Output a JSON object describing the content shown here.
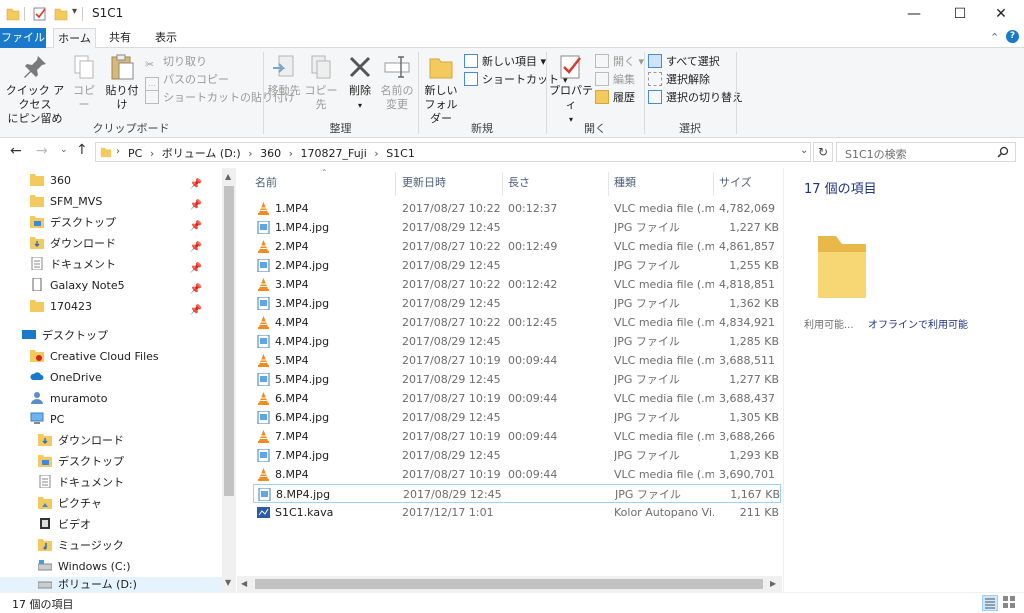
{
  "window": {
    "title": "S1C1",
    "controls": {
      "minimize": "—",
      "maximize": "☐",
      "close": "✕"
    }
  },
  "ribbon_tabs": [
    {
      "label": "ファイル"
    },
    {
      "label": "ホーム"
    },
    {
      "label": "共有"
    },
    {
      "label": "表示"
    }
  ],
  "ribbon": {
    "clipboard": {
      "pin_label": "クイック アクセス",
      "pin_label2": "にピン留め",
      "copy": "コピー",
      "paste": "貼り付け",
      "cut": "切り取り",
      "copy_path": "パスのコピー",
      "paste_shortcut": "ショートカットの貼り付け",
      "group": "クリップボード"
    },
    "organize": {
      "move_to": "移動先",
      "copy_to": "コピー先",
      "delete": "削除",
      "rename": "名前の",
      "rename2": "変更",
      "group": "整理"
    },
    "new": {
      "new_folder": "新しい",
      "new_folder2": "フォルダー",
      "new_item": "新しい項目",
      "shortcut": "ショートカット",
      "group": "新規"
    },
    "open": {
      "properties": "プロパティ",
      "open": "開く",
      "edit": "編集",
      "history": "履歴",
      "group": "開く"
    },
    "select": {
      "select_all": "すべて選択",
      "select_none": "選択解除",
      "invert": "選択の切り替え",
      "group": "選択"
    }
  },
  "address": {
    "segments": [
      "PC",
      "ボリューム (D:)",
      "360",
      "170827_Fuji",
      "S1C1"
    ],
    "search_placeholder": "S1C1の検索"
  },
  "nav": {
    "quick": [
      {
        "label": "360",
        "pinned": true
      },
      {
        "label": "SFM_MVS",
        "pinned": true
      },
      {
        "label": "デスクトップ",
        "pinned": true
      },
      {
        "label": "ダウンロード",
        "pinned": true
      },
      {
        "label": "ドキュメント",
        "pinned": true
      },
      {
        "label": "Galaxy Note5",
        "pinned": true
      },
      {
        "label": "170423",
        "pinned": true
      }
    ],
    "desktop": "デスクトップ",
    "creative_cloud": "Creative Cloud Files",
    "onedrive": "OneDrive",
    "user": "muramoto",
    "pc": "PC",
    "pc_children": [
      "ダウンロード",
      "デスクトップ",
      "ドキュメント",
      "ピクチャ",
      "ビデオ",
      "ミュージック",
      "Windows (C:)",
      "ボリューム (D:)"
    ]
  },
  "columns": {
    "name": "名前",
    "date": "更新日時",
    "length": "長さ",
    "type": "種類",
    "size": "サイズ"
  },
  "files": [
    {
      "name": "1.MP4",
      "date": "2017/08/27 10:22",
      "length": "00:12:37",
      "type": "VLC media file (.m...",
      "size": "4,782,069 ...",
      "icon": "vlc"
    },
    {
      "name": "1.MP4.jpg",
      "date": "2017/08/29 12:45",
      "length": "",
      "type": "JPG ファイル",
      "size": "1,227 KB",
      "icon": "jpg"
    },
    {
      "name": "2.MP4",
      "date": "2017/08/27 10:22",
      "length": "00:12:49",
      "type": "VLC media file (.m...",
      "size": "4,861,857 ...",
      "icon": "vlc"
    },
    {
      "name": "2.MP4.jpg",
      "date": "2017/08/29 12:45",
      "length": "",
      "type": "JPG ファイル",
      "size": "1,255 KB",
      "icon": "jpg"
    },
    {
      "name": "3.MP4",
      "date": "2017/08/27 10:22",
      "length": "00:12:42",
      "type": "VLC media file (.m...",
      "size": "4,818,851 ...",
      "icon": "vlc"
    },
    {
      "name": "3.MP4.jpg",
      "date": "2017/08/29 12:45",
      "length": "",
      "type": "JPG ファイル",
      "size": "1,362 KB",
      "icon": "jpg"
    },
    {
      "name": "4.MP4",
      "date": "2017/08/27 10:22",
      "length": "00:12:45",
      "type": "VLC media file (.m...",
      "size": "4,834,921 ...",
      "icon": "vlc"
    },
    {
      "name": "4.MP4.jpg",
      "date": "2017/08/29 12:45",
      "length": "",
      "type": "JPG ファイル",
      "size": "1,285 KB",
      "icon": "jpg"
    },
    {
      "name": "5.MP4",
      "date": "2017/08/27 10:19",
      "length": "00:09:44",
      "type": "VLC media file (.m...",
      "size": "3,688,511 ...",
      "icon": "vlc"
    },
    {
      "name": "5.MP4.jpg",
      "date": "2017/08/29 12:45",
      "length": "",
      "type": "JPG ファイル",
      "size": "1,277 KB",
      "icon": "jpg"
    },
    {
      "name": "6.MP4",
      "date": "2017/08/27 10:19",
      "length": "00:09:44",
      "type": "VLC media file (.m...",
      "size": "3,688,437 ...",
      "icon": "vlc"
    },
    {
      "name": "6.MP4.jpg",
      "date": "2017/08/29 12:45",
      "length": "",
      "type": "JPG ファイル",
      "size": "1,305 KB",
      "icon": "jpg"
    },
    {
      "name": "7.MP4",
      "date": "2017/08/27 10:19",
      "length": "00:09:44",
      "type": "VLC media file (.m...",
      "size": "3,688,266 ...",
      "icon": "vlc"
    },
    {
      "name": "7.MP4.jpg",
      "date": "2017/08/29 12:45",
      "length": "",
      "type": "JPG ファイル",
      "size": "1,293 KB",
      "icon": "jpg"
    },
    {
      "name": "8.MP4",
      "date": "2017/08/27 10:19",
      "length": "00:09:44",
      "type": "VLC media file (.m...",
      "size": "3,690,701 ...",
      "icon": "vlc"
    },
    {
      "name": "8.MP4.jpg",
      "date": "2017/08/29 12:45",
      "length": "",
      "type": "JPG ファイル",
      "size": "1,167 KB",
      "icon": "jpg",
      "selected": true
    },
    {
      "name": "S1C1.kava",
      "date": "2017/12/17 1:01",
      "length": "",
      "type": "Kolor Autopano Vi...",
      "size": "211 KB",
      "icon": "kava"
    }
  ],
  "preview": {
    "count": "17 個の項目",
    "availability_label": "利用可能...",
    "availability_value": "オフラインで利用可能"
  },
  "status": {
    "count": "17 個の項目"
  },
  "colors": {
    "accent": "#1979ca",
    "folder": "#f4c95d",
    "selection_border": "#99d1ff",
    "header_text": "#4c607a"
  }
}
